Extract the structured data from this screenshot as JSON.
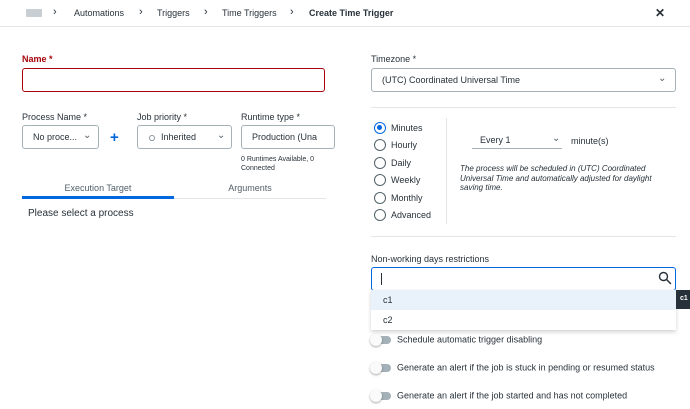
{
  "breadcrumb": {
    "items": [
      "Automations",
      "Triggers",
      "Time Triggers"
    ],
    "current": "Create Time Trigger",
    "separator": "›"
  },
  "close_icon": "close-icon",
  "form": {
    "name_label": "Name *",
    "process_label": "Process Name *",
    "process_value": "No proce...",
    "add_button": "+",
    "priority_label": "Job priority *",
    "priority_value": "Inherited",
    "runtime_label": "Runtime type *",
    "runtime_value": "Production (Una",
    "runtime_note": "0 Runtimes Available, 0 Connected",
    "tabs": [
      "Execution Target",
      "Arguments"
    ],
    "active_tab": "Execution Target",
    "select_process_msg": "Please select a process"
  },
  "schedule": {
    "timezone_label": "Timezone *",
    "timezone_value": "(UTC) Coordinated Universal Time",
    "frequencies": [
      "Minutes",
      "Hourly",
      "Daily",
      "Weekly",
      "Monthly",
      "Advanced"
    ],
    "selected_frequency": "Minutes",
    "every_value": "Every 1",
    "every_unit": "minute(s)",
    "note": "The process will be scheduled in (UTC) Coordinated Universal Time and automatically adjusted for daylight saving time."
  },
  "non_working": {
    "label": "Non-working days restrictions",
    "search_value": "",
    "options": [
      "c1",
      "c2"
    ],
    "tooltip": "c1"
  },
  "toggles": [
    "Schedule automatic trigger disabling",
    "Generate an alert if the job is stuck in pending or resumed status",
    "Generate an alert if the job started and has not completed"
  ],
  "colors": {
    "accent": "#0067df",
    "error": "#a6040a",
    "text": "#273139"
  }
}
